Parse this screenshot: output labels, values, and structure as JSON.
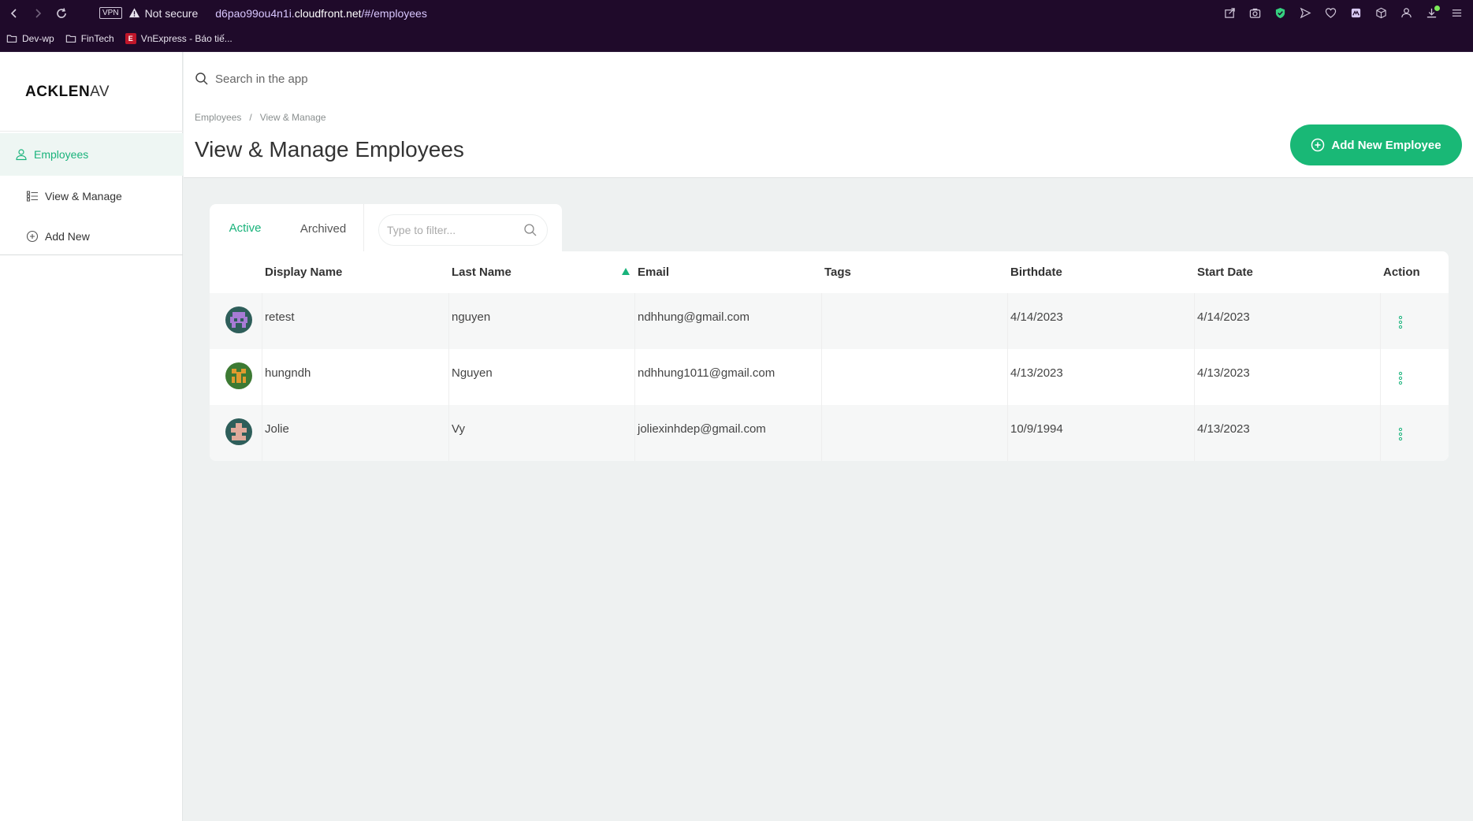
{
  "browser": {
    "vpn_label": "VPN",
    "security_label": "Not secure",
    "url_prefix": "d6pao99ou4n1i.",
    "url_host": "cloudfront.net",
    "url_path": "/#/employees",
    "bookmarks": [
      {
        "label": "Dev-wp"
      },
      {
        "label": "FinTech"
      },
      {
        "label": "VnExpress - Báo tiế..."
      }
    ]
  },
  "app": {
    "logo_bold": "ACKLEN",
    "logo_thin": "AV",
    "search_placeholder": "Search in the app",
    "sidebar": {
      "section_label": "Employees",
      "items": [
        {
          "label": "View & Manage"
        },
        {
          "label": "Add New"
        }
      ]
    },
    "breadcrumb": [
      "Employees",
      "/",
      "View & Manage"
    ],
    "page_title": "View & Manage Employees",
    "add_button_label": "Add New Employee",
    "tabs": [
      {
        "label": "Active",
        "selected": true
      },
      {
        "label": "Archived",
        "selected": false
      }
    ],
    "filter_placeholder": "Type to filter...",
    "table": {
      "columns": [
        "Display Name",
        "Last Name",
        "Email",
        "Tags",
        "Birthdate",
        "Start Date",
        "Action"
      ],
      "sort_column": "Email",
      "rows": [
        {
          "display_name": "retest",
          "last_name": "nguyen",
          "email": "ndhhung@gmail.com",
          "tags": "",
          "birthdate": "4/14/2023",
          "start_date": "4/14/2023"
        },
        {
          "display_name": "hungndh",
          "last_name": "Nguyen",
          "email": "ndhhung1011@gmail.com",
          "tags": "",
          "birthdate": "4/13/2023",
          "start_date": "4/13/2023"
        },
        {
          "display_name": "Jolie",
          "last_name": "Vy",
          "email": "joliexinhdep@gmail.com",
          "tags": "",
          "birthdate": "10/9/1994",
          "start_date": "4/13/2023"
        }
      ]
    }
  },
  "colors": {
    "accent": "#19b876",
    "chrome_bg": "#1f0a2a",
    "content_bg": "#eef1f1"
  }
}
